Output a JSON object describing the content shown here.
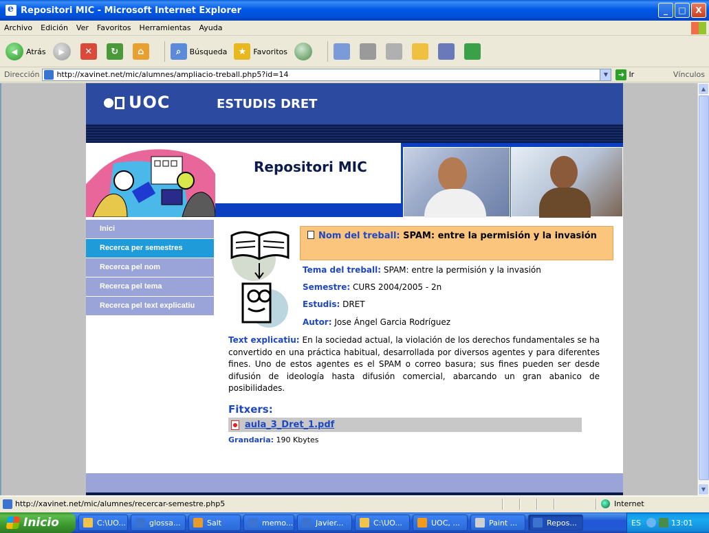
{
  "window": {
    "title": "Repositori MIC - Microsoft Internet Explorer",
    "btn_min": "_",
    "btn_max": "□",
    "btn_close": "X"
  },
  "menu": [
    "Archivo",
    "Edición",
    "Ver",
    "Favoritos",
    "Herramientas",
    "Ayuda"
  ],
  "toolbar": {
    "back_label": "Atrás",
    "search_label": "Búsqueda",
    "favorites_label": "Favoritos",
    "arrow_glyph": "◀",
    "forward_glyph": "▶",
    "stop_glyph": "✕",
    "refresh_glyph": "↻",
    "home_glyph": "⌂",
    "search_glyph": "⌕",
    "fav_glyph": "★"
  },
  "address": {
    "label": "Dirección",
    "url": "http://xavinet.net/mic/alumnes/ampliacio-treball.php5?id=14",
    "go_label": "Ir",
    "links_label": "Vínculos",
    "dropdown_glyph": "▼",
    "go_glyph": "➜"
  },
  "page": {
    "logo": "UOC",
    "studies": "ESTUDIS DRET",
    "repo_title": "Repositori MIC",
    "nav": [
      {
        "label": "Inici",
        "active": false
      },
      {
        "label": "Recerca per semestres",
        "active": true
      },
      {
        "label": "Recerca pel nom",
        "active": false
      },
      {
        "label": "Recerca pel tema",
        "active": false
      },
      {
        "label": "Recerca pel text explicatiu",
        "active": false
      }
    ],
    "work": {
      "name_label": "Nom del treball:",
      "name_value": "SPAM: entre la permisión y la invasión",
      "topic_label": "Tema del treball:",
      "topic_value": "SPAM: entre la permisión y la invasión",
      "semester_label": "Semestre:",
      "semester_value": "CURS 2004/2005 - 2n",
      "studies_label": "Estudis:",
      "studies_value": "DRET",
      "author_label": "Autor:",
      "author_value": "Jose Ángel Garcia Rodríguez",
      "explic_label": "Text explicatiu:",
      "explic_value": "En la sociedad actual, la violación de los derechos fundamentales se ha convertido en una práctica habitual, desarrollada por diversos agentes y para diferentes fines. Uno de estos agentes es el SPAM o correo basura; sus fines pueden ser desde difusión de ideología hasta difusión comercial, abarcando un gran abanico de posibilidades."
    },
    "files": {
      "title": "Fitxers:",
      "filename": "aula_3_Dret_1.pdf",
      "size_label": "Grandaria:",
      "size_value": "190 Kbytes"
    }
  },
  "status": {
    "url": "http://xavinet.net/mic/alumnes/recercar-semestre.php5",
    "zone": "Internet"
  },
  "taskbar": {
    "start": "Inicio",
    "tasks": [
      {
        "label": "C:\\UO...",
        "color": "#f3c24a"
      },
      {
        "label": "glossa...",
        "color": "#3a74d0"
      },
      {
        "label": "Salt",
        "color": "#e89a2a"
      },
      {
        "label": "memo...",
        "color": "#3a74d0"
      },
      {
        "label": "Javier...",
        "color": "#3a74d0"
      },
      {
        "label": "C:\\UO...",
        "color": "#f3c24a"
      },
      {
        "label": "UOC, ...",
        "color": "#f39a1a"
      },
      {
        "label": "Paint ...",
        "color": "#d0d0d0"
      },
      {
        "label": "Repos...",
        "color": "#3a74d0"
      }
    ],
    "tray_lang": "ES",
    "clock": "13:01"
  }
}
